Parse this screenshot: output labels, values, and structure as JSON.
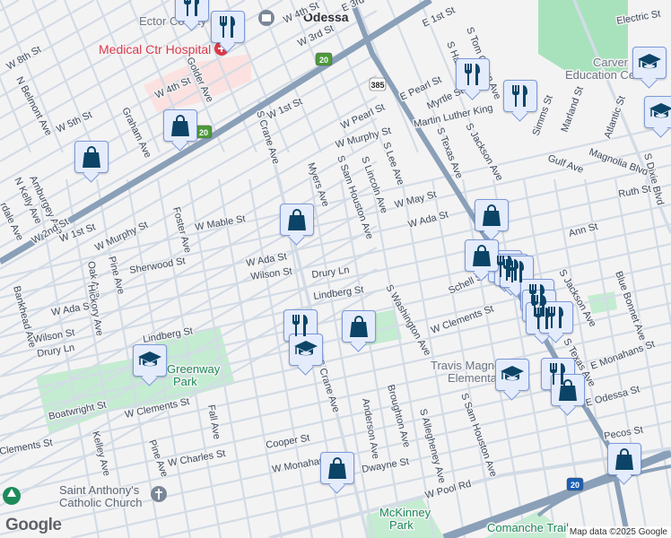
{
  "map": {
    "colors": {
      "background": "#f4f3f4",
      "road": "#d3dce6",
      "highway": "#8aa0b8",
      "park": "#a8e2bd",
      "hospital": "#fbe1df",
      "marker_fill": "#e4ecfc",
      "marker_icon": "#0b4466"
    },
    "labels": {
      "ector_library": "Ector County Library",
      "hospital": "Medical Ctr Hospital",
      "odessa": "Odessa",
      "w8th": "W 8th St",
      "belmont": "N Belmont Ave",
      "w5th": "W 5th St",
      "graham": "Graham Ave",
      "w4th_a": "W 4th St",
      "golder": "Golder Ave",
      "w4th_b": "W 4th St",
      "w3rd": "W 3rd St",
      "w1st_a": "W 1st St",
      "crane_a": "S Crane Ave",
      "amburgey": "Amburgey Ave",
      "nkelly": "N Kelly Ave",
      "rdale": "rdale Ave",
      "w2nd": "W 2nd St",
      "w1st_b": "W 1st St",
      "wmurphy_a": "W Murphy St",
      "foster": "Foster Ave",
      "wmable": "W Mable St",
      "myers": "Myers Ave",
      "wada_a": "W Ada St",
      "sherwood": "Sherwood St",
      "pine_a": "Pine Ave",
      "oak": "Oak Ave",
      "wilson_a": "Wilson St",
      "drury_a": "Drury Ln",
      "lindberg_a": "Lindberg St",
      "bankhead": "Bankhead Ave",
      "wada_b": "W Ada St",
      "hickory": "Hickory Ave",
      "wilson_b": "Wilson St",
      "drury_b": "Drury Ln",
      "lindberg_b": "Lindberg St",
      "greenway1": "Greenway",
      "greenway2": "Park",
      "boatwright": "Boatwright St",
      "wclements_a": "W Clements St",
      "clements": "Clements St",
      "kelley": "Kelley Ave",
      "pine_b": "Pine Ave",
      "wcharles": "W Charles St",
      "fall": "Fall Ave",
      "cooper": "Cooper St",
      "wmonahans": "W Monahans St",
      "crane_b": "S Crane Ave",
      "church1": "Saint Anthony's",
      "church2": "Catholic Church",
      "e3rd": "E 3rd St",
      "e1st": "E 1st St",
      "tomgreen": "S Tom Green Ave",
      "hale": "S Hale Ave",
      "electric": "Electric St",
      "carver1": "Carver",
      "carver2": "Education Center",
      "epearl": "E Pearl St",
      "myrtle": "Myrtle St",
      "wpearl": "W Pearl St",
      "mlk": "Martin Luther King",
      "wmurphy_b": "W Murphy St",
      "stexas_a": "S Texas Ave",
      "sjackson_a": "S Jackson Ave",
      "simms": "Simms St",
      "marland": "Marland St",
      "atlantic": "Atlantic St",
      "slee": "S Lee Ave",
      "slincoln": "S Lincoln Ave",
      "ssamhouston_a": "S Sam Houston Ave",
      "magnolia": "Magnolia Blvd",
      "gulf": "Gulf Ave",
      "dixie": "S Dixie Blvd",
      "ruth": "Ruth St",
      "wmay": "W May St",
      "wada_c": "W Ada St",
      "ann": "Ann St",
      "schell": "Schell St",
      "swashington": "S Washington Ave",
      "wclements_b": "W Clements St",
      "sjackson_b": "S Jackson Ave",
      "bluebonnet": "Blue Bonnet Ave",
      "stexas_b": "S Texas Ave",
      "emonahans": "E Monahans St",
      "travis1": "Travis Magnet",
      "travis2": "Elementary",
      "eodessa": "E Odessa St",
      "pecos": "Pecos St",
      "anderson": "Anderson Ave",
      "broughton": "Broughton Ave",
      "allegheney": "S Allegheney Ave",
      "ssamhouston_b": "S Sam Houston Ave",
      "dwayne": "Dwayne St",
      "wpool": "W Pool Rd",
      "mckinney1": "McKinney",
      "mckinney2": "Park",
      "comanche": "Comanche Trail"
    },
    "shields": [
      "20",
      "20",
      "385",
      "20"
    ],
    "markers": [
      {
        "type": "restaurant"
      },
      {
        "type": "restaurant"
      },
      {
        "type": "restaurant"
      },
      {
        "type": "restaurant"
      },
      {
        "type": "restaurant"
      },
      {
        "type": "restaurant"
      },
      {
        "type": "restaurant"
      },
      {
        "type": "restaurant"
      },
      {
        "type": "restaurant"
      },
      {
        "type": "restaurant"
      },
      {
        "type": "restaurant"
      },
      {
        "type": "restaurant"
      },
      {
        "type": "restaurant"
      },
      {
        "type": "shopping"
      },
      {
        "type": "shopping"
      },
      {
        "type": "shopping"
      },
      {
        "type": "shopping"
      },
      {
        "type": "shopping"
      },
      {
        "type": "shopping"
      },
      {
        "type": "shopping"
      },
      {
        "type": "shopping"
      },
      {
        "type": "shopping"
      },
      {
        "type": "education"
      },
      {
        "type": "education"
      },
      {
        "type": "education"
      },
      {
        "type": "education"
      },
      {
        "type": "education"
      }
    ],
    "attribution": "Map data ©2025 Google",
    "logo": "Google"
  }
}
